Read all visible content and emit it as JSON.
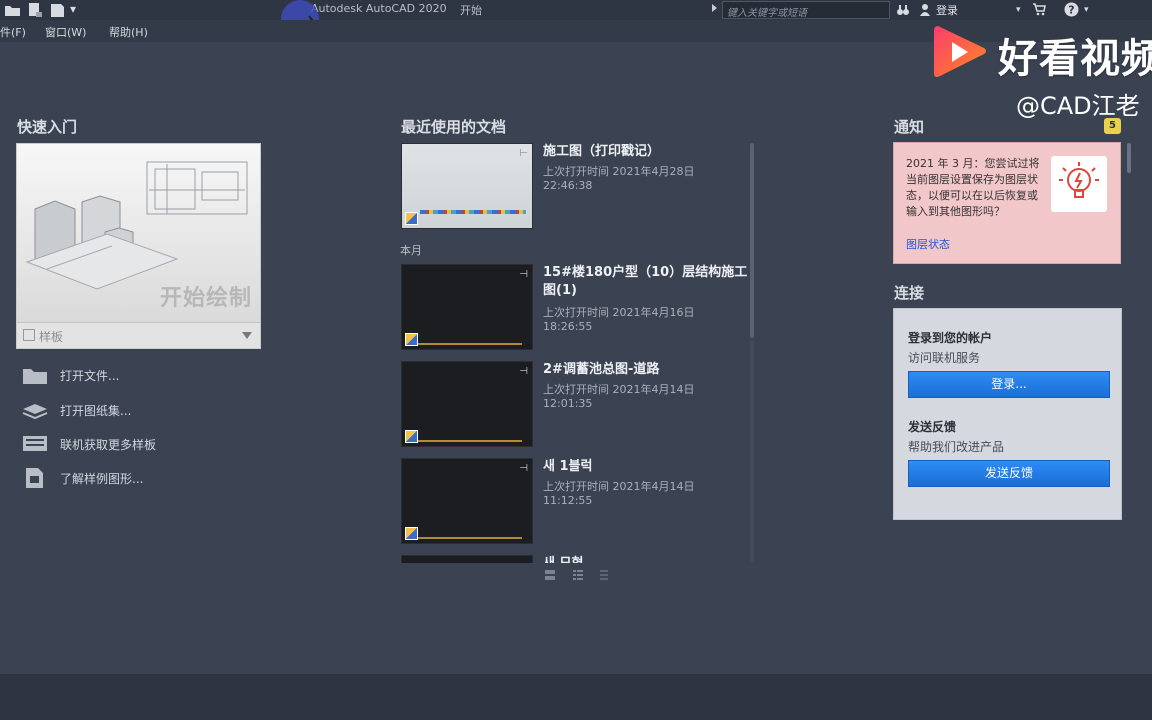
{
  "window": {
    "title": "Autodesk AutoCAD 2020",
    "tab": "开始"
  },
  "search": {
    "placeholder": "键入关键字或短语"
  },
  "account": {
    "login_label": "登录"
  },
  "menu": {
    "file": "件(F)",
    "window": "窗口(W)",
    "help": "帮助(H)"
  },
  "quick_start": {
    "title": "快速入门",
    "start_drawing": "开始绘制",
    "template_label": "样板",
    "links": [
      {
        "label": "打开文件...",
        "icon": "folder-icon"
      },
      {
        "label": "打开图纸集...",
        "icon": "sheet-set-icon"
      },
      {
        "label": "联机获取更多样板",
        "icon": "online-templates-icon"
      },
      {
        "label": "了解样例图形...",
        "icon": "sample-drawings-icon"
      }
    ]
  },
  "recent": {
    "title": "最近使用的文档",
    "group_label": "本月",
    "docs": [
      {
        "name": "施工图（打印戳记）",
        "time": "上次打开时间 2021年4月28日 22:46:38"
      },
      {
        "name": "15#楼180户型（10）层结构施工图(1)",
        "time": "上次打开时间 2021年4月16日 18:26:55"
      },
      {
        "name": "2#调蓄池总图-道路",
        "time": "上次打开时间 2021年4月14日 12:01:35"
      },
      {
        "name": "새 1블럭",
        "time": "上次打开时间 2021年4月14日 11:12:55"
      },
      {
        "name": "새 모형",
        "time": ""
      }
    ]
  },
  "notifications": {
    "title": "通知",
    "count": "5",
    "message": "2021 年 3 月：您尝试过将当前图层设置保存为图层状态，以便可以在以后恢复或输入到其他图形吗？",
    "link": "图层状态"
  },
  "connect": {
    "title": "连接",
    "signin_heading": "登录到您的帐户",
    "signin_sub": "访问联机服务",
    "signin_button": "登录...",
    "feedback_heading": "发送反馈",
    "feedback_sub": "帮助我们改进产品",
    "feedback_button": "发送反馈"
  },
  "watermark": {
    "brand": "好看视频",
    "handle": "@CAD江老"
  },
  "colors": {
    "background": "#3b4353",
    "accent_button": "#1a6ed8",
    "notification_bg": "#f1c7c9"
  }
}
